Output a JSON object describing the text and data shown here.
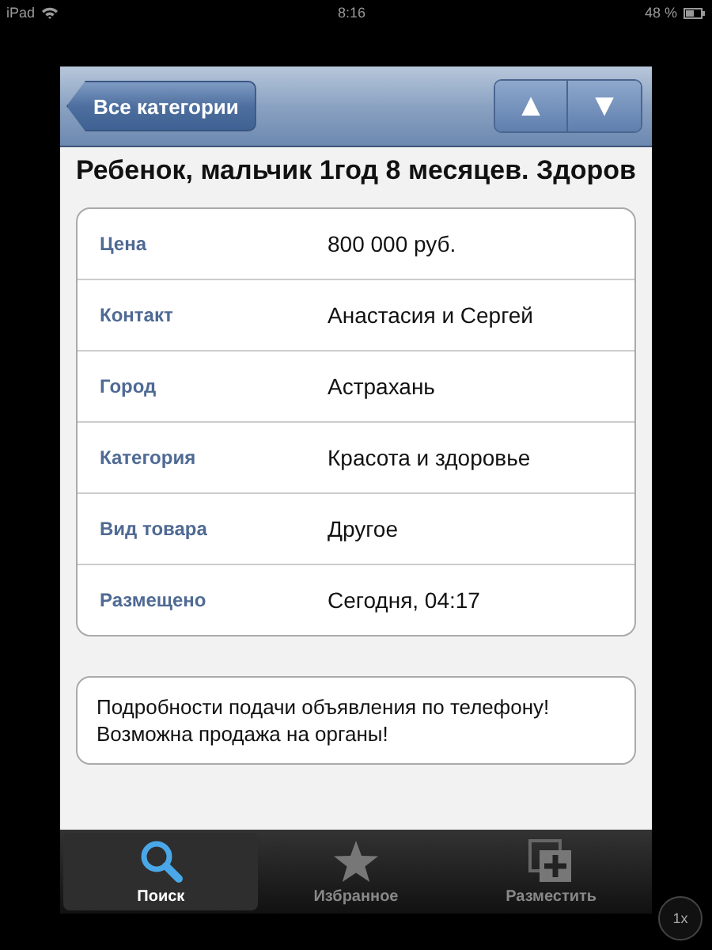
{
  "status_bar": {
    "device": "iPad",
    "time": "8:16",
    "battery": "48 %"
  },
  "nav_bar": {
    "back_button": "Все категории",
    "arrows": [
      "▲",
      "▼"
    ]
  },
  "title": "Ребенок, мальчик 1год 8 месяцев. Здоров",
  "details": [
    {
      "label": "Цена",
      "value": "800 000 руб."
    },
    {
      "label": "Контакт",
      "value": "Анастасия и Сергей"
    },
    {
      "label": "Город",
      "value": "Астрахань"
    },
    {
      "label": "Категория",
      "value": "Красота и здоровье"
    },
    {
      "label": "Вид товара",
      "value": "Другое"
    },
    {
      "label": "Размещено",
      "value": "Сегодня, 04:17"
    }
  ],
  "description": "Подробности подачи объявления по телефону!Возможна продажа на органы!",
  "tab_bar": [
    {
      "label": "Поиск",
      "kind": "search",
      "selected": true
    },
    {
      "label": "Избранное",
      "kind": "star",
      "selected": false
    },
    {
      "label": "Разместить",
      "kind": "add",
      "selected": false
    }
  ],
  "zoom_button": "1x"
}
